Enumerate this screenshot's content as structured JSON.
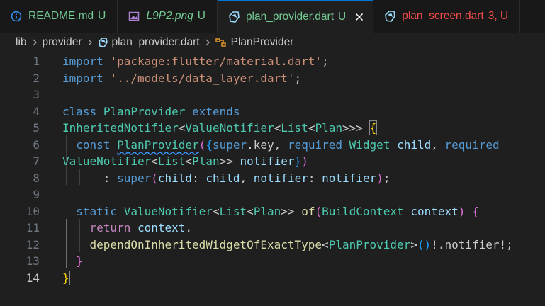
{
  "tabs": [
    {
      "name": "README.md",
      "status": "U",
      "icon": "info-icon",
      "italic": false,
      "active": false,
      "error": false
    },
    {
      "name": "L9P2.png",
      "status": "U",
      "icon": "image-icon",
      "italic": true,
      "active": false,
      "error": false
    },
    {
      "name": "plan_provider.dart",
      "status": "U",
      "icon": "dart-icon",
      "italic": false,
      "active": true,
      "error": false
    },
    {
      "name": "plan_screen.dart",
      "status": "3, U",
      "icon": "dart-icon",
      "italic": false,
      "active": false,
      "error": true
    }
  ],
  "breadcrumb": {
    "items": [
      "lib",
      "provider",
      "plan_provider.dart",
      "PlanProvider"
    ]
  },
  "editor": {
    "current_line": 14,
    "lines": [
      [
        [
          "kw",
          "import"
        ],
        [
          "",
          "␣"
        ],
        [
          "str",
          "'package:flutter/material.dart'"
        ],
        [
          "",
          ";"
        ]
      ],
      [
        [
          "kw",
          "import"
        ],
        [
          "",
          "␣"
        ],
        [
          "str",
          "'../models/data_layer.dart'"
        ],
        [
          "",
          ";"
        ]
      ],
      [],
      [
        [
          "kw",
          "class"
        ],
        [
          "",
          "␣"
        ],
        [
          "cls",
          "PlanProvider"
        ],
        [
          "",
          "␣"
        ],
        [
          "kw",
          "extends"
        ]
      ],
      [
        [
          "cls",
          "InheritedNotifier"
        ],
        [
          "",
          "<"
        ],
        [
          "cls",
          "ValueNotifier"
        ],
        [
          "",
          "<"
        ],
        [
          "cls",
          "List"
        ],
        [
          "",
          "<"
        ],
        [
          "cls",
          "Plan"
        ],
        [
          "",
          ">>>"
        ],
        [
          "",
          "␣"
        ],
        [
          "p1bm",
          "{"
        ]
      ],
      [
        [
          "",
          "␣␣"
        ],
        [
          "kw",
          "const"
        ],
        [
          "",
          "␣"
        ],
        [
          "clsq",
          "PlanProvider"
        ],
        [
          "p2",
          "("
        ],
        [
          "p3",
          "{"
        ],
        [
          "kw",
          "super"
        ],
        [
          "",
          ".key,"
        ],
        [
          "",
          "␣"
        ],
        [
          "kw",
          "required"
        ],
        [
          "",
          "␣"
        ],
        [
          "cls",
          "Widget"
        ],
        [
          "",
          "␣"
        ],
        [
          "var",
          "child"
        ],
        [
          "",
          ","
        ],
        [
          "",
          "␣"
        ],
        [
          "kw",
          "required"
        ]
      ],
      [
        [
          "cls",
          "ValueNotifier"
        ],
        [
          "",
          "<"
        ],
        [
          "cls",
          "List"
        ],
        [
          "",
          "<"
        ],
        [
          "cls",
          "Plan"
        ],
        [
          "",
          ">>"
        ],
        [
          "",
          "␣"
        ],
        [
          "var",
          "notifier"
        ],
        [
          "p3",
          "}"
        ],
        [
          "p2",
          ")"
        ]
      ],
      [
        [
          "",
          "␣␣␣␣␣␣:"
        ],
        [
          "",
          "␣"
        ],
        [
          "kw",
          "super"
        ],
        [
          "p2",
          "("
        ],
        [
          "var",
          "child"
        ],
        [
          "",
          ":"
        ],
        [
          "",
          "␣"
        ],
        [
          "var",
          "child"
        ],
        [
          "",
          ","
        ],
        [
          "",
          "␣"
        ],
        [
          "var",
          "notifier"
        ],
        [
          "",
          ":"
        ],
        [
          "",
          "␣"
        ],
        [
          "var",
          "notifier"
        ],
        [
          "p2",
          ")"
        ],
        [
          "",
          ";"
        ]
      ],
      [],
      [
        [
          "",
          "␣␣"
        ],
        [
          "kw",
          "static"
        ],
        [
          "",
          "␣"
        ],
        [
          "cls",
          "ValueNotifier"
        ],
        [
          "",
          "<"
        ],
        [
          "cls",
          "List"
        ],
        [
          "",
          "<"
        ],
        [
          "cls",
          "Plan"
        ],
        [
          "",
          ">>"
        ],
        [
          "",
          "␣"
        ],
        [
          "fn",
          "of"
        ],
        [
          "p2",
          "("
        ],
        [
          "cls",
          "BuildContext"
        ],
        [
          "",
          "␣"
        ],
        [
          "var",
          "context"
        ],
        [
          "p2",
          ")"
        ],
        [
          "",
          "␣"
        ],
        [
          "p2",
          "{"
        ]
      ],
      [
        [
          "",
          "␣␣␣␣"
        ],
        [
          "kw2",
          "return"
        ],
        [
          "",
          "␣"
        ],
        [
          "var",
          "context"
        ],
        [
          "",
          "."
        ]
      ],
      [
        [
          "",
          "␣␣␣␣"
        ],
        [
          "fn",
          "dependOnInheritedWidgetOfExactType"
        ],
        [
          "",
          "<"
        ],
        [
          "cls",
          "PlanProvider"
        ],
        [
          "",
          ">"
        ],
        [
          "p3",
          "()"
        ],
        [
          "",
          "!.notifier!;"
        ]
      ],
      [
        [
          "",
          "␣␣"
        ],
        [
          "p2",
          "}"
        ]
      ],
      [
        [
          "p1bm",
          "}"
        ]
      ]
    ]
  }
}
